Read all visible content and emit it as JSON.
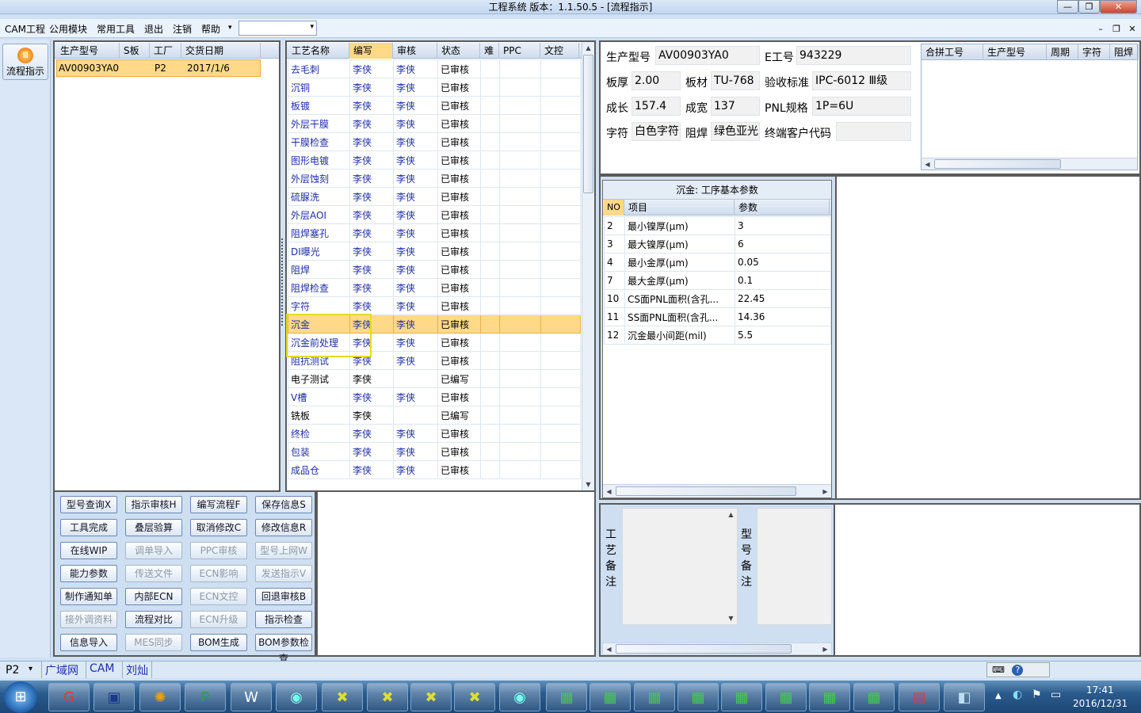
{
  "window": {
    "title": "工程系统   版本：1.1.50.5 - [流程指示]"
  },
  "menu": {
    "items": [
      "CAM工程",
      "公用模块",
      "常用工具",
      "退出",
      "注销",
      "帮助"
    ]
  },
  "left": {
    "flow_button": "流程指示"
  },
  "joblist": {
    "headers": [
      "生产型号",
      "S板",
      "工厂",
      "交货日期"
    ],
    "rows": [
      {
        "model": "AV00903YA0",
        "s": "",
        "factory": "P2",
        "date": "2017/1/6"
      }
    ]
  },
  "process": {
    "headers": [
      "工艺名称",
      "编写",
      "审核",
      "状态",
      "难",
      "PPC",
      "文控"
    ],
    "rows": [
      [
        "去毛刺",
        "李侠",
        "李侠",
        "已审核"
      ],
      [
        "沉铜",
        "李侠",
        "李侠",
        "已审核"
      ],
      [
        "板镀",
        "李侠",
        "李侠",
        "已审核"
      ],
      [
        "外层干膜",
        "李侠",
        "李侠",
        "已审核"
      ],
      [
        "干膜检查",
        "李侠",
        "李侠",
        "已审核"
      ],
      [
        "图形电镀",
        "李侠",
        "李侠",
        "已审核"
      ],
      [
        "外层蚀刻",
        "李侠",
        "李侠",
        "已审核"
      ],
      [
        "硫脲洗",
        "李侠",
        "李侠",
        "已审核"
      ],
      [
        "外层AOI",
        "李侠",
        "李侠",
        "已审核"
      ],
      [
        "阻焊塞孔",
        "李侠",
        "李侠",
        "已审核"
      ],
      [
        "DI曝光",
        "李侠",
        "李侠",
        "已审核"
      ],
      [
        "阻焊",
        "李侠",
        "李侠",
        "已审核"
      ],
      [
        "阻焊检查",
        "李侠",
        "李侠",
        "已审核"
      ],
      [
        "字符",
        "李侠",
        "李侠",
        "已审核"
      ],
      [
        "沉金",
        "李侠",
        "李侠",
        "已审核"
      ],
      [
        "沉金前处理",
        "李侠",
        "李侠",
        "已审核"
      ],
      [
        "阻抗测试",
        "李侠",
        "李侠",
        "已审核"
      ],
      [
        "电子测试",
        "李侠",
        "",
        "已编写"
      ],
      [
        "V槽",
        "李侠",
        "李侠",
        "已审核"
      ],
      [
        "铣板",
        "李侠",
        "",
        "已编写"
      ],
      [
        "终检",
        "李侠",
        "李侠",
        "已审核"
      ],
      [
        "包装",
        "李侠",
        "李侠",
        "已审核"
      ],
      [
        "成品仓",
        "李侠",
        "李侠",
        "已审核"
      ]
    ]
  },
  "func_buttons": [
    [
      "型号查询X",
      "指示审核H",
      "编写流程F",
      "保存信息S"
    ],
    [
      "工具完成",
      "叠层验算",
      "取消修改C",
      "修改信息R"
    ],
    [
      "在线WIP",
      "调单导入",
      "PPC审核",
      "型号上网W"
    ],
    [
      "能力参数",
      "传送文件",
      "ECN影响",
      "发送指示V"
    ],
    [
      "制作通知单",
      "内部ECN",
      "ECN文控",
      "回退审核B"
    ],
    [
      "接外调资料",
      "流程对比",
      "ECN升级",
      "指示检查"
    ],
    [
      "信息导入",
      "MES同步",
      "BOM生成",
      "BOM参数检查"
    ]
  ],
  "info": {
    "model_label": "生产型号",
    "model": "AV00903YA0",
    "eno_label": "E工号",
    "eno": "943229",
    "thick_label": "板厚",
    "thick": "2.00",
    "mat_label": "板材",
    "mat": "TU-768",
    "std_label": "验收标准",
    "std": "IPC-6012 Ⅲ级",
    "len_label": "成长",
    "len": "157.4",
    "wid_label": "成宽",
    "wid": "137",
    "pnl_label": "PNL规格",
    "pnl": "1P=6U",
    "char_label": "字符",
    "char": "白色字符",
    "mask_label": "阻焊",
    "mask": "绿色亚光",
    "cust_label": "终端客户代码",
    "cust": ""
  },
  "combine": {
    "headers": [
      "合拼工号",
      "生产型号",
      "周期",
      "字符",
      "阻焊"
    ]
  },
  "params": {
    "title": "沉金: 工序基本参数",
    "headers": [
      "NO",
      "项目",
      "参数"
    ],
    "rows": [
      [
        "2",
        "最小镍厚(μm)",
        "3"
      ],
      [
        "3",
        "最大镍厚(μm)",
        "6"
      ],
      [
        "4",
        "最小金厚(μm)",
        "0.05"
      ],
      [
        "7",
        "最大金厚(μm)",
        "0.1"
      ],
      [
        "10",
        "CS面PNL面积(含孔...",
        "22.45"
      ],
      [
        "11",
        "SS面PNL面积(含孔...",
        "14.36"
      ],
      [
        "12",
        "沉金最小间距(mil)",
        "5.5"
      ]
    ]
  },
  "notes": {
    "process_label": "工艺备注",
    "model_label": "型号备注"
  },
  "status": {
    "site": "P2",
    "net": "广域网",
    "module": "CAM",
    "user": "刘灿"
  },
  "clock": {
    "time": "17:41",
    "date": "2016/12/31"
  }
}
